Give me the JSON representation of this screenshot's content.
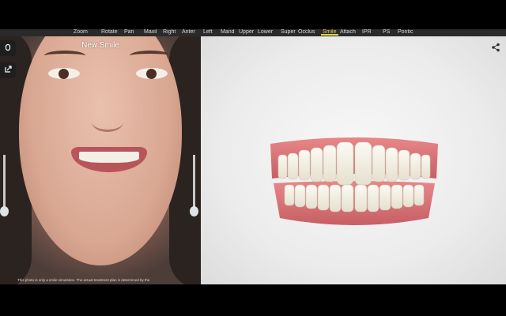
{
  "toolbar": {
    "items": [
      {
        "label": "Zoom",
        "active": false
      },
      {
        "label": "Rotate",
        "active": false
      },
      {
        "label": "Pan",
        "active": false
      },
      {
        "label": "Maxil",
        "active": false
      },
      {
        "label": "Right",
        "active": false
      },
      {
        "label": "Anter",
        "active": false
      },
      {
        "label": "Left",
        "active": false
      },
      {
        "label": "Mand",
        "active": false
      },
      {
        "label": "Upper",
        "active": false
      },
      {
        "label": "Lower",
        "active": false
      },
      {
        "label": "Super",
        "active": false
      },
      {
        "label": "Occlus",
        "active": false
      },
      {
        "label": "Smile",
        "active": true
      },
      {
        "label": "Attach",
        "active": false
      },
      {
        "label": "IPR",
        "active": false
      },
      {
        "label": "PS",
        "active": false
      },
      {
        "label": "Pontic",
        "active": false
      }
    ],
    "active_color": "#e8d44a"
  },
  "photo": {
    "title": "New Smile",
    "disclaimer": "This photo is only a smile simulation. The actual treatment plan is determined by the",
    "side_buttons": [
      {
        "icon": "toggle-icon"
      },
      {
        "icon": "export-icon"
      }
    ]
  },
  "model": {
    "share_icon": "share-icon"
  }
}
